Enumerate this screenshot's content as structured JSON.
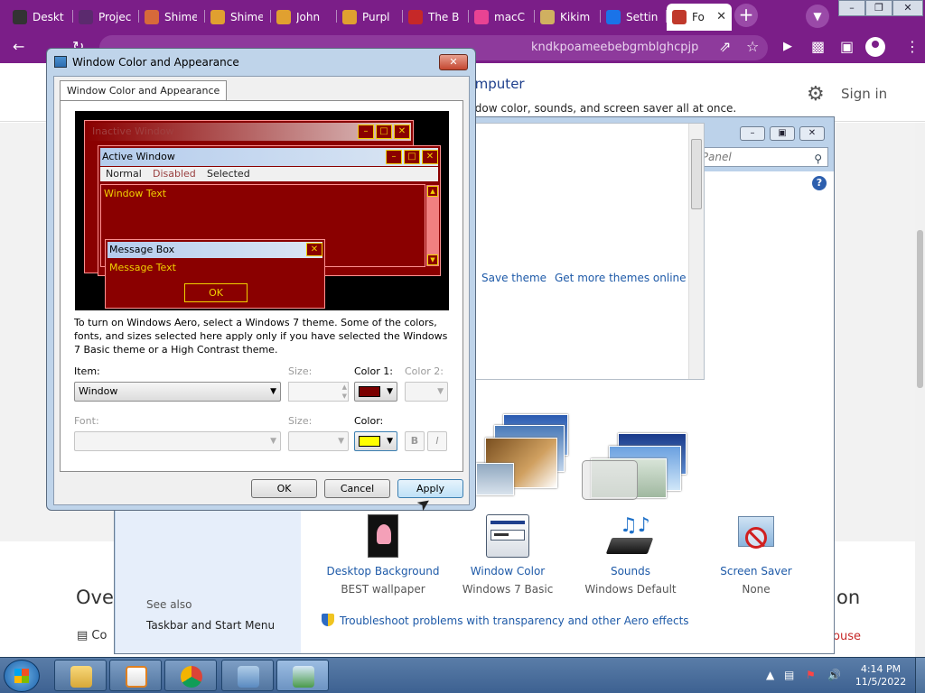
{
  "browser": {
    "tabs": [
      {
        "label": "Deskt",
        "icon": "panel-icon",
        "fav": "#333"
      },
      {
        "label": "Projec",
        "icon": "project-icon",
        "fav": "#5b2a6e"
      },
      {
        "label": "Shime",
        "icon": "shimeji-icon",
        "fav": "#d76a3a"
      },
      {
        "label": "Shime",
        "icon": "monkey-icon",
        "fav": "#e0a030"
      },
      {
        "label": "John",
        "icon": "monkey-icon",
        "fav": "#e0a030"
      },
      {
        "label": "Purpl",
        "icon": "monkey-icon",
        "fav": "#e0a030"
      },
      {
        "label": "The B",
        "icon": "video-icon",
        "fav": "#c62828"
      },
      {
        "label": "macC",
        "icon": "puzzle-icon",
        "fav": "#e84393"
      },
      {
        "label": "Kikim",
        "icon": "kiki-icon",
        "fav": "#d0b060"
      },
      {
        "label": "Settin",
        "icon": "gear-icon",
        "fav": "#1a73e8"
      },
      {
        "label": "Fo",
        "icon": "web-icon",
        "fav": "#c0392b",
        "active": true
      }
    ],
    "new_tab": "+",
    "url": "kndkpoameebebgmblghcpjp",
    "sign_in": "Sign in"
  },
  "page": {
    "overview": "Ove",
    "on": "on",
    "co": "Co",
    "ouse": "ouse"
  },
  "control_panel": {
    "search_placeholder": "Search Control Panel",
    "title": "ounds on your computer",
    "description": "ktop background, window color, sounds, and screen saver all at once.",
    "save_theme": "Save theme",
    "more_themes": "Get more themes online",
    "items": [
      {
        "title": "Desktop Background",
        "sub": "BEST wallpaper",
        "icon": "wallpaper-icon"
      },
      {
        "title": "Window Color",
        "sub": "Windows 7 Basic",
        "icon": "window-color-icon"
      },
      {
        "title": "Sounds",
        "sub": "Windows Default",
        "icon": "sounds-icon"
      },
      {
        "title": "Screen Saver",
        "sub": "None",
        "icon": "screen-saver-icon"
      }
    ],
    "see_also": "See also",
    "taskbar_link": "Taskbar and Start Menu",
    "troubleshoot": "Troubleshoot problems with transparency and other Aero effects"
  },
  "dialog": {
    "title": "Window Color and Appearance",
    "tab": "Window Color and Appearance",
    "preview": {
      "inactive": "Inactive Window",
      "active": "Active Window",
      "menu_normal": "Normal",
      "menu_disabled": "Disabled",
      "menu_selected": "Selected",
      "window_text": "Window Text",
      "message_box": "Message Box",
      "message_text": "Message Text",
      "ok": "OK"
    },
    "description": "To turn on Windows Aero, select a Windows 7 theme.  Some of the colors, fonts, and sizes selected here apply only if you have selected the Windows 7 Basic theme or a High Contrast theme.",
    "item_label": "Item:",
    "item_value": "Window",
    "size_label": "Size:",
    "color1_label": "Color 1:",
    "color2_label": "Color 2:",
    "font_label": "Font:",
    "size2_label": "Size:",
    "color_label": "Color:",
    "bold": "B",
    "italic": "I",
    "color1": "#7a0000",
    "font_color": "#ffff00",
    "ok": "OK",
    "cancel": "Cancel",
    "apply": "Apply"
  },
  "taskbar": {
    "time": "4:14 PM",
    "date": "11/5/2022"
  }
}
